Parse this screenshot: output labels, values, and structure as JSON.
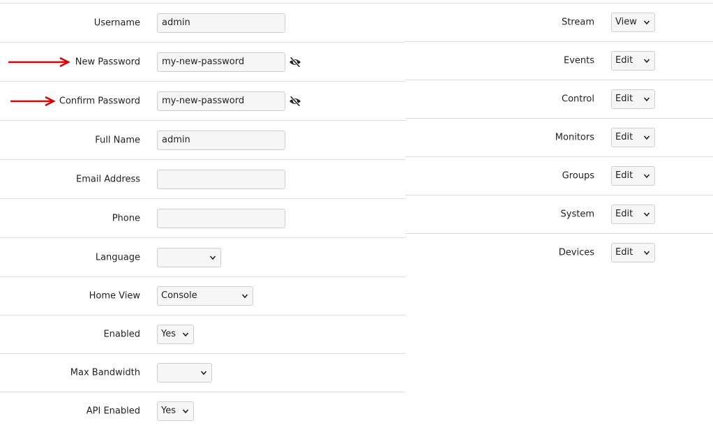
{
  "user_form": {
    "username": {
      "label": "Username",
      "value": "admin"
    },
    "new_password": {
      "label": "New Password",
      "value": "my-new-password"
    },
    "confirm_password": {
      "label": "Confirm Password",
      "value": "my-new-password"
    },
    "full_name": {
      "label": "Full Name",
      "value": "admin"
    },
    "email": {
      "label": "Email Address",
      "value": ""
    },
    "phone": {
      "label": "Phone",
      "value": ""
    },
    "language": {
      "label": "Language",
      "value": ""
    },
    "home_view": {
      "label": "Home View",
      "value": "Console"
    },
    "enabled": {
      "label": "Enabled",
      "value": "Yes"
    },
    "max_bandwidth": {
      "label": "Max Bandwidth",
      "value": ""
    },
    "api_enabled": {
      "label": "API Enabled",
      "value": "Yes"
    }
  },
  "permissions": [
    {
      "label": "Stream",
      "value": "View"
    },
    {
      "label": "Events",
      "value": "Edit"
    },
    {
      "label": "Control",
      "value": "Edit"
    },
    {
      "label": "Monitors",
      "value": "Edit"
    },
    {
      "label": "Groups",
      "value": "Edit"
    },
    {
      "label": "System",
      "value": "Edit"
    },
    {
      "label": "Devices",
      "value": "Edit"
    }
  ],
  "icons": {
    "password_toggle": "eye-slash-icon",
    "annotation": "red-arrow",
    "dropdown": "chevron-down-icon"
  },
  "colors": {
    "arrow": "#e00000",
    "row_border": "#dedede",
    "input_bg": "#f6f6f6"
  }
}
